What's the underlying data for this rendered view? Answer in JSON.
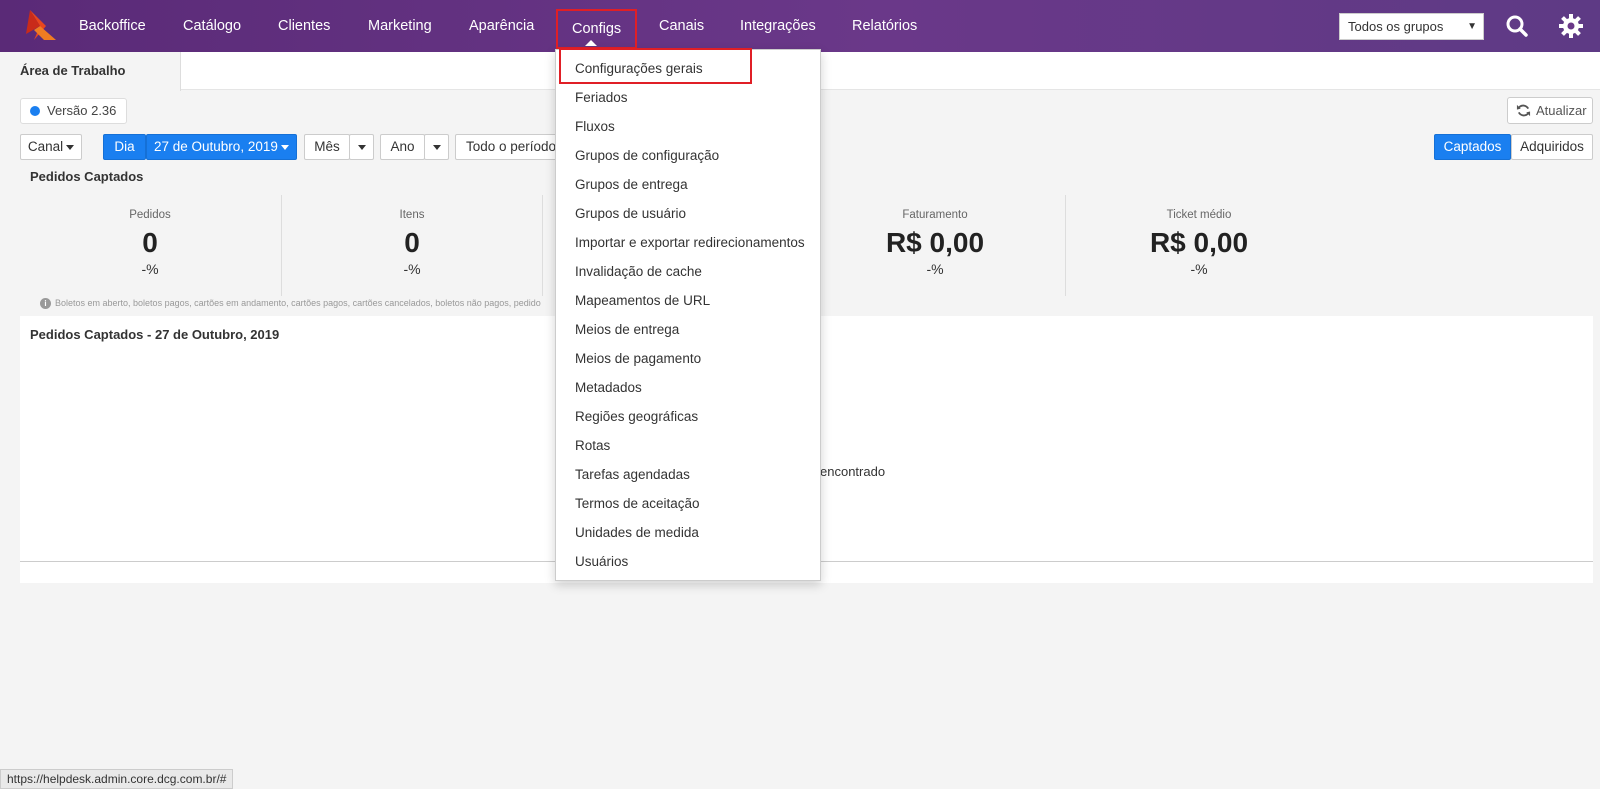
{
  "nav": {
    "items": [
      "Backoffice",
      "Catálogo",
      "Clientes",
      "Marketing",
      "Aparência",
      "Configs",
      "Canais",
      "Integrações",
      "Relatórios"
    ],
    "active": "Configs",
    "group_select": "Todos os grupos"
  },
  "tabs": {
    "active": "Área de Trabalho"
  },
  "version": "Versão 2.36",
  "refresh_label": "Atualizar",
  "filters": {
    "canal": "Canal",
    "dia": "Dia",
    "date": "27 de Outubro, 2019",
    "mes": "Mês",
    "ano": "Ano",
    "periodo": "Todo o período"
  },
  "toggle": {
    "captados": "Captados",
    "adquiridos": "Adquiridos"
  },
  "summary": {
    "title": "Pedidos Captados",
    "stats": [
      {
        "label": "Pedidos",
        "value": "0",
        "pct": "-%"
      },
      {
        "label": "Itens",
        "value": "0",
        "pct": "-%"
      },
      {
        "label": "Faturamento",
        "value": "R$ 0,00",
        "pct": "-%"
      },
      {
        "label": "Ticket médio",
        "value": "R$ 0,00",
        "pct": "-%"
      }
    ],
    "note": "Boletos em aberto, boletos pagos, cartões em andamento, cartões pagos, cartões cancelados, boletos não pagos, pedido"
  },
  "chart_panel": {
    "title": "Pedidos Captados - 27 de Outubro, 2019",
    "empty": "encontrado"
  },
  "configs_menu": [
    "Configurações gerais",
    "Feriados",
    "Fluxos",
    "Grupos de configuração",
    "Grupos de entrega",
    "Grupos de usuário",
    "Importar e exportar redirecionamentos",
    "Invalidação de cache",
    "Mapeamentos de URL",
    "Meios de entrega",
    "Meios de pagamento",
    "Metadados",
    "Regiões geográficas",
    "Rotas",
    "Tarefas agendadas",
    "Termos de aceitação",
    "Unidades de medida",
    "Usuários"
  ],
  "status_url": "https://helpdesk.admin.core.dcg.com.br/#",
  "colors": {
    "nav": "#5a2a77",
    "accent": "#1a7ff0",
    "highlight": "#e01f26"
  }
}
